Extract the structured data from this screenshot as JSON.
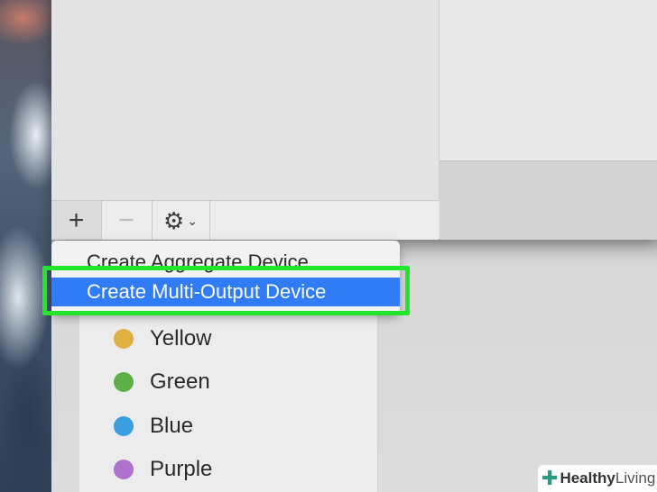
{
  "menu": {
    "items": [
      {
        "label": "Create Aggregate Device",
        "selected": false
      },
      {
        "label": "Create Multi-Output Device",
        "selected": true
      }
    ],
    "highlight_color": "#2f7cf6"
  },
  "toolbar": {
    "add_label": "+",
    "remove_label": "−",
    "gear_icon": "gear-icon",
    "chevron_icon": "chevron-down-icon"
  },
  "tags": [
    {
      "label": "Yellow",
      "color": "#e0b040"
    },
    {
      "label": "Green",
      "color": "#5cb04a"
    },
    {
      "label": "Blue",
      "color": "#3a9ee0"
    },
    {
      "label": "Purple",
      "color": "#b070d0"
    }
  ],
  "annotation": {
    "outline_color": "#22e62a"
  },
  "watermark": {
    "part1": "Healthy",
    "part2": "Living"
  }
}
